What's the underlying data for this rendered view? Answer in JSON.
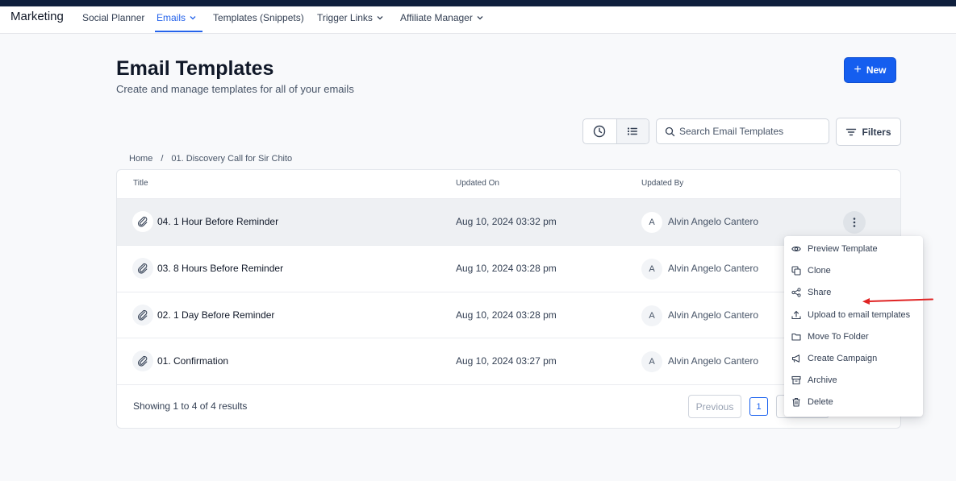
{
  "nav": {
    "brand": "Marketing",
    "items": [
      {
        "label": "Social Planner",
        "has_chevron": false,
        "active": false
      },
      {
        "label": "Emails",
        "has_chevron": true,
        "active": true
      },
      {
        "label": "Templates (Snippets)",
        "has_chevron": false,
        "active": false
      },
      {
        "label": "Trigger Links",
        "has_chevron": true,
        "active": false
      },
      {
        "label": "Affiliate Manager",
        "has_chevron": true,
        "active": false
      }
    ]
  },
  "header": {
    "title": "Email Templates",
    "subtitle": "Create and manage templates for all of your emails",
    "new_button": "New"
  },
  "toolbar": {
    "search_placeholder": "Search Email Templates",
    "filters_label": "Filters",
    "view_icons": [
      "clock-icon",
      "list-icon"
    ]
  },
  "breadcrumb": {
    "home": "Home",
    "separator": "/",
    "current": "01. Discovery Call for Sir Chito"
  },
  "table": {
    "columns": [
      "Title",
      "Updated On",
      "Updated By"
    ],
    "rows": [
      {
        "title": "04. 1 Hour Before Reminder",
        "updated_on": "Aug 10, 2024 03:32 pm",
        "avatar": "A",
        "updated_by": "Alvin Angelo Cantero"
      },
      {
        "title": "03. 8 Hours Before Reminder",
        "updated_on": "Aug 10, 2024 03:28 pm",
        "avatar": "A",
        "updated_by": "Alvin Angelo Cantero"
      },
      {
        "title": "02. 1 Day Before Reminder",
        "updated_on": "Aug 10, 2024 03:28 pm",
        "avatar": "A",
        "updated_by": "Alvin Angelo Cantero"
      },
      {
        "title": "01. Confirmation",
        "updated_on": "Aug 10, 2024 03:27 pm",
        "avatar": "A",
        "updated_by": "Alvin Angelo Cantero"
      }
    ],
    "showing": "Showing 1 to 4 of 4 results",
    "pagination": {
      "previous": "Previous",
      "current_page": "1"
    }
  },
  "context_menu": {
    "items": [
      {
        "label": "Preview Template",
        "icon": "eye-icon"
      },
      {
        "label": "Clone",
        "icon": "copy-icon"
      },
      {
        "label": "Share",
        "icon": "share-icon"
      },
      {
        "label": "Upload to email templates",
        "icon": "upload-icon"
      },
      {
        "label": "Move To Folder",
        "icon": "folder-icon"
      },
      {
        "label": "Create Campaign",
        "icon": "megaphone-icon"
      },
      {
        "label": "Archive",
        "icon": "archive-icon"
      },
      {
        "label": "Delete",
        "icon": "trash-icon"
      }
    ]
  },
  "colors": {
    "accent": "#155eef",
    "top_strip": "#0f1f3d",
    "annotation_arrow": "#e02424"
  }
}
